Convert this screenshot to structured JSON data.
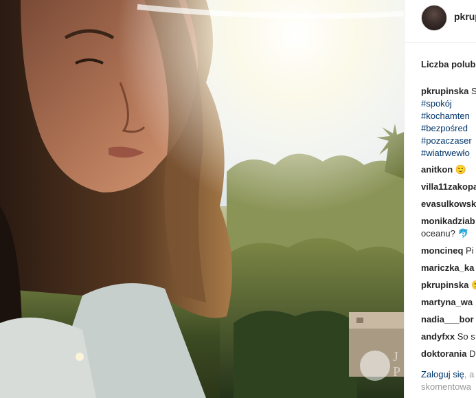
{
  "post": {
    "username": "pkrup",
    "likes_label": "Liczba polub"
  },
  "caption": {
    "username": "pkrupinska",
    "text": "S",
    "hashtags": [
      "#spokój",
      "#kochamten",
      "#bezpośred",
      "#pozaczaser",
      "#wiatrwewło"
    ]
  },
  "comments": [
    {
      "user": "anitkon",
      "text": "🙂"
    },
    {
      "user": "villa11zakopa",
      "text": ""
    },
    {
      "user": "evasulkowsk",
      "text": ""
    },
    {
      "user": "monikadziab",
      "text": "",
      "continuation": "oceanu? 🐬"
    },
    {
      "user": "moncineq",
      "text": "Pi"
    },
    {
      "user": "mariczka_ka",
      "text": ""
    },
    {
      "user": "pkrupinska",
      "text": "🙂"
    },
    {
      "user": "martyna_wa",
      "text": ""
    },
    {
      "user": "nadia___bor",
      "text": ""
    },
    {
      "user": "andyfxx",
      "text": "So s"
    },
    {
      "user": "doktorania",
      "text": "D"
    }
  ],
  "footer": {
    "login_link": "Zaloguj się",
    "login_rest": ", a",
    "login_line2": "skomentowa"
  },
  "watermark": {
    "text": "J\nP"
  },
  "colors": {
    "link": "#003569",
    "text": "#262626",
    "muted": "#999999"
  }
}
